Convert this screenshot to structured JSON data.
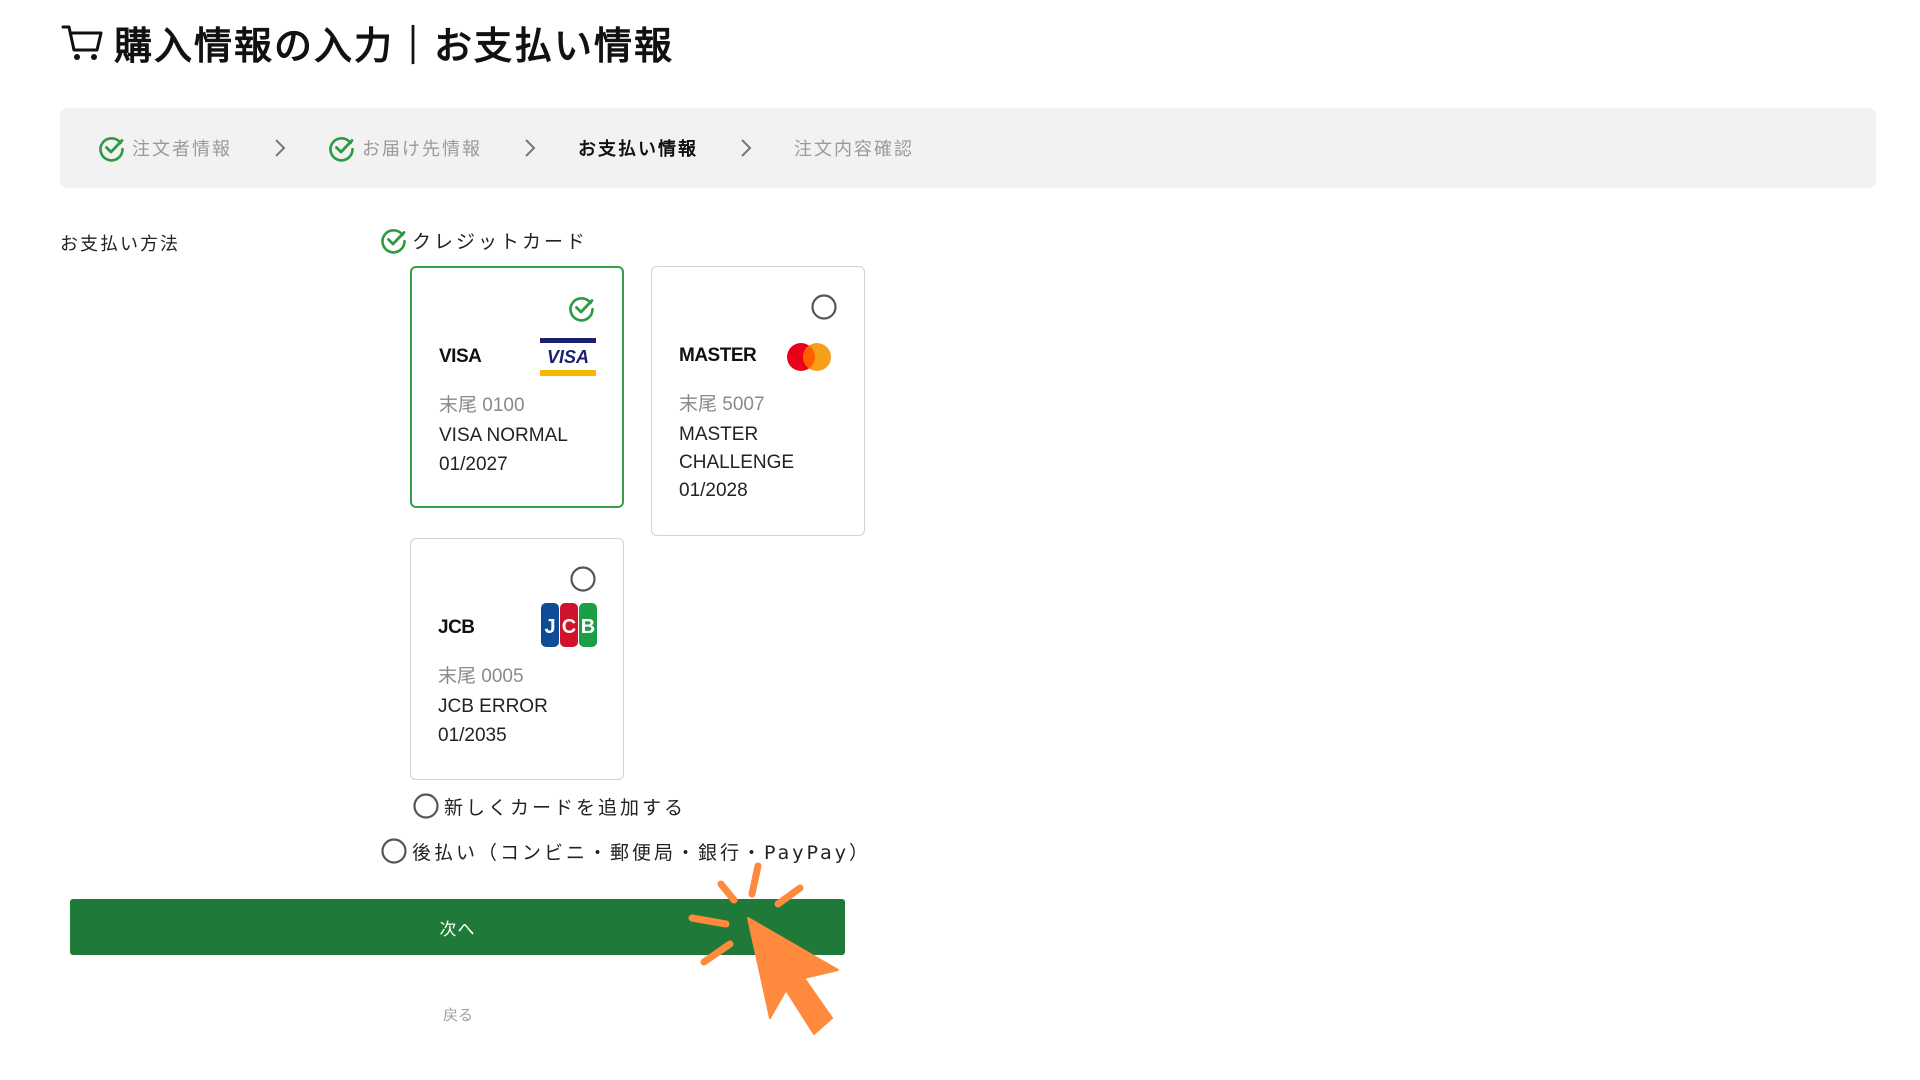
{
  "header": {
    "title": "購入情報の入力｜お支払い情報",
    "cart_icon": "cart-icon"
  },
  "stepper": {
    "steps": [
      {
        "label": "注文者情報",
        "state": "done"
      },
      {
        "label": "お届け先情報",
        "state": "done"
      },
      {
        "label": "お支払い情報",
        "state": "current"
      },
      {
        "label": "注文内容確認",
        "state": "upcoming"
      }
    ]
  },
  "payment": {
    "section_label": "お支払い方法",
    "credit_card_label": "クレジットカード",
    "cards": [
      {
        "brand": "VISA",
        "logo": "visa-logo",
        "tail": "末尾 0100",
        "holder": "VISA NORMAL",
        "expiry": "01/2027",
        "selected": true
      },
      {
        "brand": "MASTER",
        "logo": "mastercard-logo",
        "tail": "末尾 5007",
        "holder": "MASTER CHALLENGE",
        "expiry": "01/2028",
        "selected": false
      },
      {
        "brand": "JCB",
        "logo": "jcb-logo",
        "tail": "末尾 0005",
        "holder": "JCB ERROR",
        "expiry": "01/2035",
        "selected": false
      }
    ],
    "add_card_label": "新しくカードを追加する",
    "deferred_label": "後払い（コンビニ・郵便局・銀行・PayPay）"
  },
  "actions": {
    "next_label": "次へ",
    "back_label": "戻る"
  },
  "colors": {
    "accent_green": "#1f7a39",
    "check_green": "#2e9a42",
    "pointer_orange": "#ff8a3d",
    "stepper_bg": "#f2f2f2"
  }
}
